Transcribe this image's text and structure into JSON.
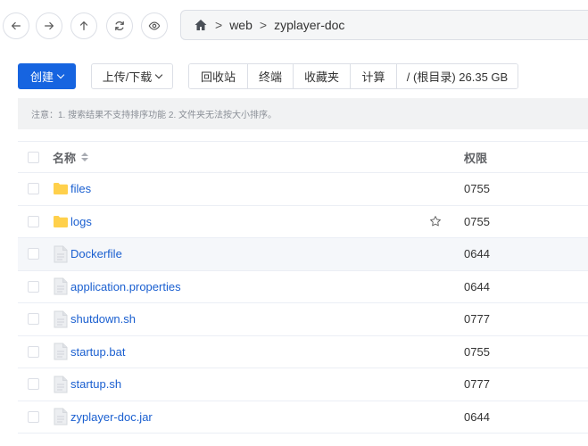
{
  "nav": {
    "back_icon": "arrow-left-icon",
    "forward_icon": "arrow-right-icon",
    "up_icon": "arrow-up-icon",
    "refresh_icon": "refresh-icon",
    "view_icon": "eye-icon"
  },
  "breadcrumb": {
    "separator": ">",
    "items": [
      "web",
      "zyplayer-doc"
    ]
  },
  "toolbar": {
    "create_label": "创建",
    "transfer_label": "上传/下载",
    "recycle_label": "回收站",
    "terminal_label": "终端",
    "favorites_label": "收藏夹",
    "calculate_label": "计算",
    "disk_label": "/ (根目录) 26.35 GB"
  },
  "notice": {
    "text": "注意：1. 搜索结果不支持排序功能 2. 文件夹无法按大小排序。"
  },
  "table": {
    "header_name": "名称",
    "header_perm": "权限",
    "rows": [
      {
        "name": "files",
        "type": "folder",
        "perm": "0755"
      },
      {
        "name": "logs",
        "type": "folder",
        "perm": "0755"
      },
      {
        "name": "Dockerfile",
        "type": "file",
        "perm": "0644"
      },
      {
        "name": "application.properties",
        "type": "file",
        "perm": "0644"
      },
      {
        "name": "shutdown.sh",
        "type": "file",
        "perm": "0777"
      },
      {
        "name": "startup.bat",
        "type": "file",
        "perm": "0755"
      },
      {
        "name": "startup.sh",
        "type": "file",
        "perm": "0777"
      },
      {
        "name": "zyplayer-doc.jar",
        "type": "file",
        "perm": "0644"
      }
    ]
  },
  "colors": {
    "primary": "#1664e0",
    "link": "#1a5fd0",
    "folder": "#ffd04b"
  }
}
